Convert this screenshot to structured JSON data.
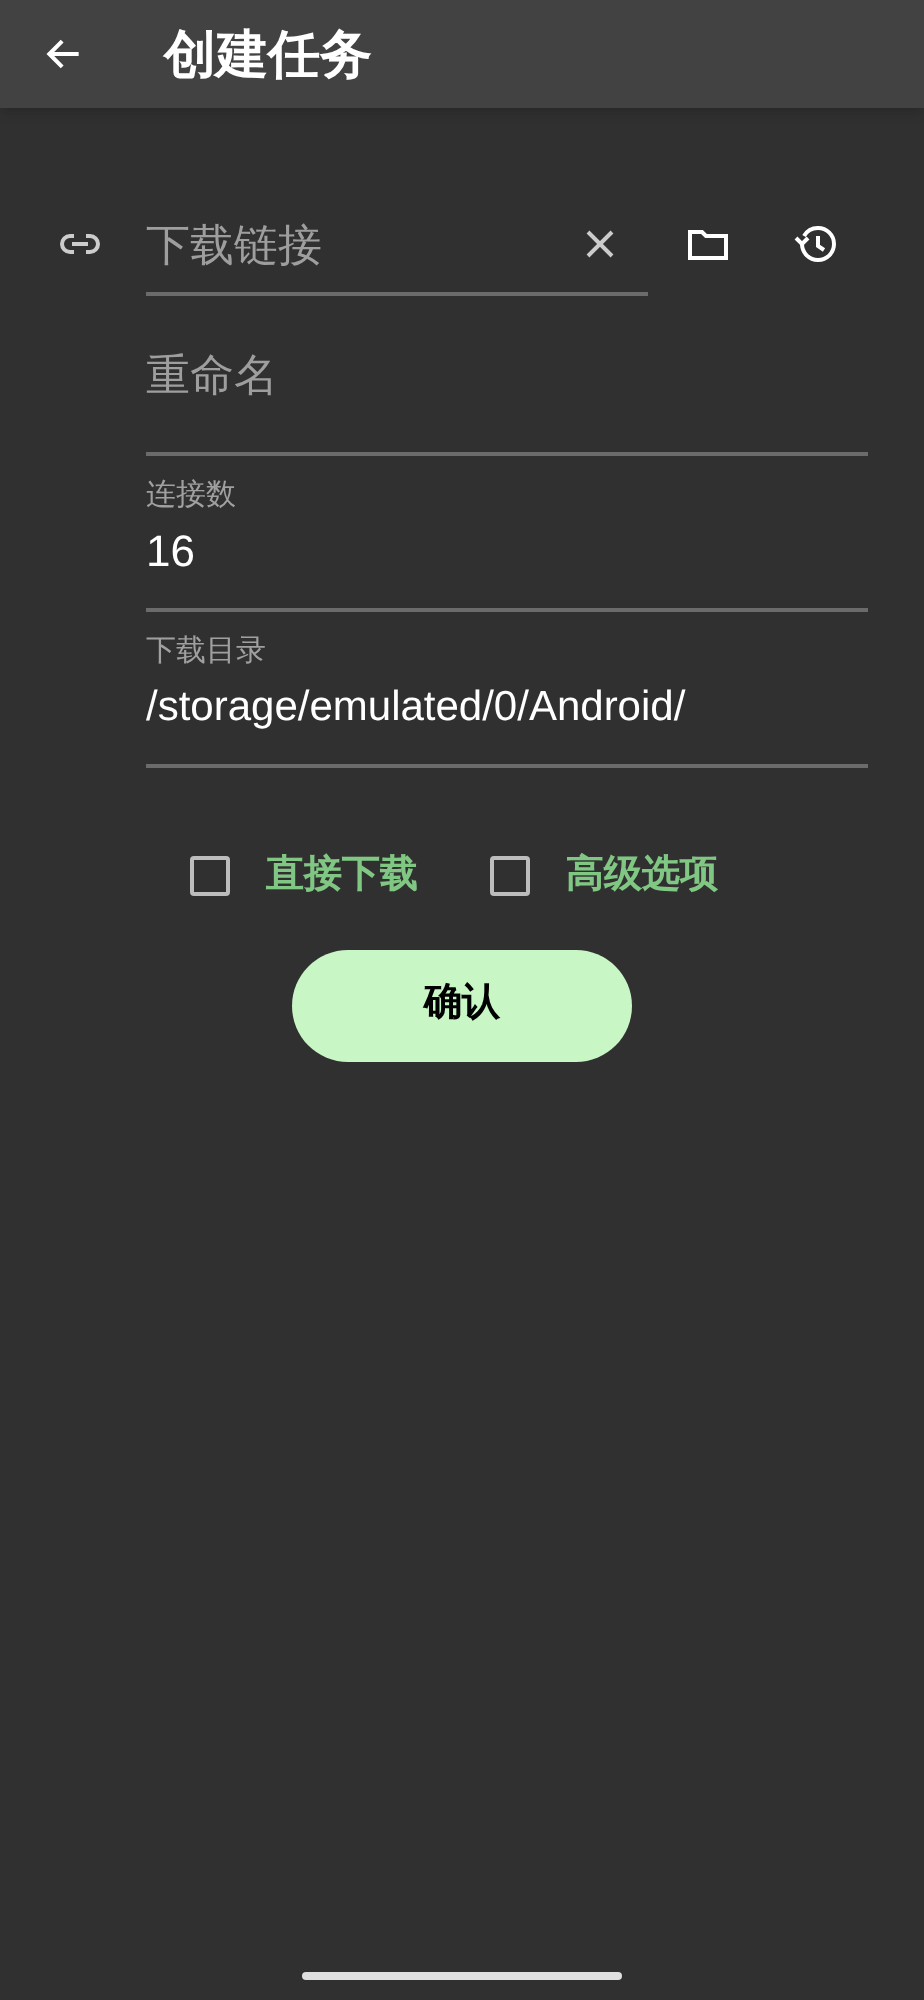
{
  "app_bar": {
    "title": "创建任务"
  },
  "url_field": {
    "placeholder": "下载链接"
  },
  "rename_field": {
    "placeholder": "重命名"
  },
  "connections_field": {
    "label": "连接数",
    "value": "16"
  },
  "directory_field": {
    "label": "下载目录",
    "value": "/storage/emulated/0/Android/"
  },
  "options": [
    {
      "label": "直接下载",
      "checked": false
    },
    {
      "label": "高级选项",
      "checked": false
    }
  ],
  "confirm_button": {
    "label": "确认"
  }
}
